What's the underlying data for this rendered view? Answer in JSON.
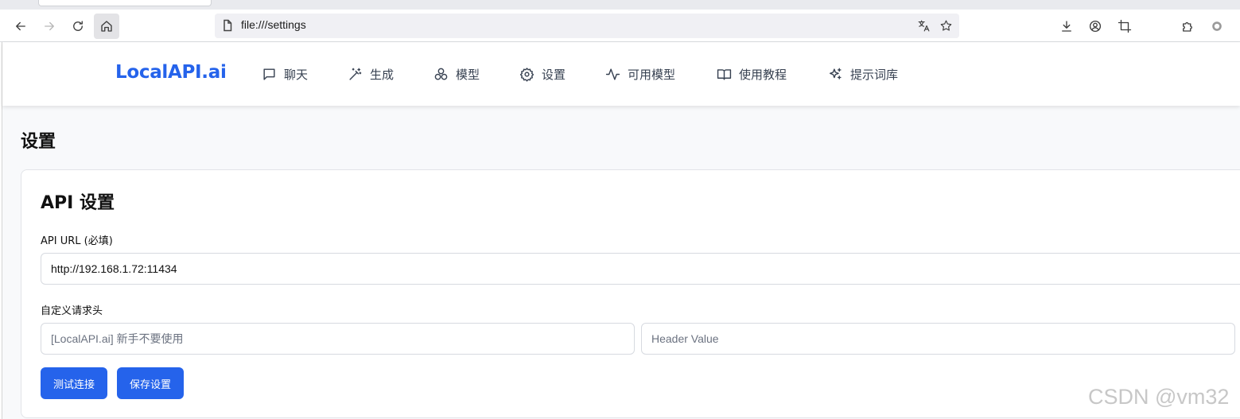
{
  "browser": {
    "url": "file:///settings"
  },
  "nav": {
    "brand": "LocalAPI.ai",
    "items": [
      {
        "label": "聊天",
        "icon": "chat-icon"
      },
      {
        "label": "生成",
        "icon": "magic-wand-icon"
      },
      {
        "label": "模型",
        "icon": "models-icon"
      },
      {
        "label": "设置",
        "icon": "gear-icon"
      },
      {
        "label": "可用模型",
        "icon": "activity-icon"
      },
      {
        "label": "使用教程",
        "icon": "book-icon"
      },
      {
        "label": "提示词库",
        "icon": "sparkles-icon"
      }
    ]
  },
  "page": {
    "title": "设置"
  },
  "api_settings": {
    "title": "API 设置",
    "url_label": "API URL (必填)",
    "url_value": "http://192.168.1.72:11434",
    "headers_label": "自定义请求头",
    "header_key_placeholder": "[LocalAPI.ai] 新手不要使用",
    "header_value_placeholder": "Header Value",
    "test_button": "测试连接",
    "save_button": "保存设置"
  },
  "watermark": "CSDN @vm32"
}
